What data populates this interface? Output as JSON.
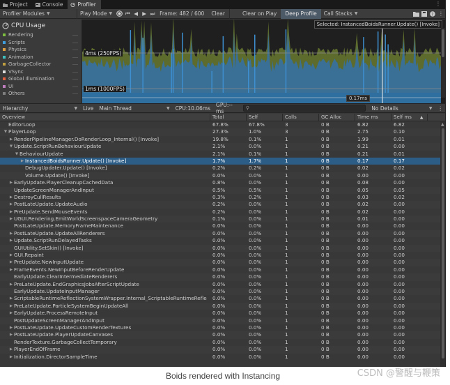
{
  "tabs": [
    {
      "label": "Project",
      "icon": "folder-icon"
    },
    {
      "label": "Console",
      "icon": "console-icon"
    },
    {
      "label": "Profiler",
      "icon": "profiler-icon"
    }
  ],
  "toolbar": {
    "modules": "Profiler Modules",
    "play_mode": "Play Mode",
    "frame": "Frame: 482 / 600",
    "clear": "Clear",
    "clear_on_play": "Clear on Play",
    "deep_profile": "Deep Profile",
    "call_stacks": "Call Stacks"
  },
  "chart": {
    "module_title": "CPU Usage",
    "selected": "Selected: InstancedBoidsRunner.Update() [Invoke]",
    "label_250": "4ms (250FPS)",
    "label_1000": "1ms (1000FPS)",
    "selection_ms": "0.17ms",
    "legend": [
      {
        "label": "Rendering",
        "color": "#7fbf3f"
      },
      {
        "label": "Scripts",
        "color": "#3f9fdf"
      },
      {
        "label": "Physics",
        "color": "#df9f3f"
      },
      {
        "label": "Animation",
        "color": "#3fbfbf"
      },
      {
        "label": "GarbageCollector",
        "color": "#bf9f3f"
      },
      {
        "label": "VSync",
        "color": "#dfdfdf"
      },
      {
        "label": "Global Illumination",
        "color": "#df5f3f"
      },
      {
        "label": "UI",
        "color": "#bf7fbf"
      },
      {
        "label": "Others",
        "color": "#7f7f7f"
      }
    ]
  },
  "hierarchy_bar": {
    "view": "Hierarchy",
    "live": "Live",
    "thread": "Main Thread",
    "cpu": "CPU:10.06ms",
    "gpu": "GPU:--ms",
    "search_icon": "search-icon",
    "details": "No Details"
  },
  "columns": [
    "Overview",
    "Total",
    "Self",
    "Calls",
    "GC Alloc",
    "Time ms",
    "Self ms"
  ],
  "rows": [
    {
      "indent": 0,
      "arrow": "",
      "name": "EditorLoop",
      "total": "67.8%",
      "self": "67.8%",
      "calls": "3",
      "gc": "0 B",
      "time": "6.82",
      "selfms": "6.82"
    },
    {
      "indent": 0,
      "arrow": "down",
      "name": "PlayerLoop",
      "total": "27.3%",
      "self": "1.0%",
      "calls": "3",
      "gc": "0 B",
      "time": "2.75",
      "selfms": "0.10"
    },
    {
      "indent": 1,
      "arrow": "right",
      "name": "RenderPipelineManager.DoRenderLoop_Internal() [Invoke]",
      "total": "19.8%",
      "self": "0.1%",
      "calls": "1",
      "gc": "0 B",
      "time": "1.99",
      "selfms": "0.01"
    },
    {
      "indent": 1,
      "arrow": "down",
      "name": "Update.ScriptRunBehaviourUpdate",
      "total": "2.1%",
      "self": "0.0%",
      "calls": "1",
      "gc": "0 B",
      "time": "0.21",
      "selfms": "0.00"
    },
    {
      "indent": 2,
      "arrow": "down",
      "name": "BehaviourUpdate",
      "total": "2.1%",
      "self": "0.1%",
      "calls": "1",
      "gc": "0 B",
      "time": "0.21",
      "selfms": "0.01"
    },
    {
      "indent": 3,
      "arrow": "right",
      "name": "InstancedBoidsRunner.Update() [Invoke]",
      "total": "1.7%",
      "self": "1.7%",
      "calls": "1",
      "gc": "0 B",
      "time": "0.17",
      "selfms": "0.17",
      "selected": true
    },
    {
      "indent": 3,
      "arrow": "",
      "name": "DebugUpdater.Update() [Invoke]",
      "total": "0.2%",
      "self": "0.2%",
      "calls": "1",
      "gc": "0 B",
      "time": "0.02",
      "selfms": "0.02"
    },
    {
      "indent": 3,
      "arrow": "",
      "name": "Volume.Update() [Invoke]",
      "total": "0.0%",
      "self": "0.0%",
      "calls": "1",
      "gc": "0 B",
      "time": "0.00",
      "selfms": "0.00"
    },
    {
      "indent": 1,
      "arrow": "right",
      "name": "EarlyUpdate.PlayerCleanupCachedData",
      "total": "0.8%",
      "self": "0.0%",
      "calls": "1",
      "gc": "0 B",
      "time": "0.08",
      "selfms": "0.00"
    },
    {
      "indent": 1,
      "arrow": "",
      "name": "UpdateScreenManagerAndInput",
      "total": "0.5%",
      "self": "0.5%",
      "calls": "1",
      "gc": "0 B",
      "time": "0.05",
      "selfms": "0.05"
    },
    {
      "indent": 1,
      "arrow": "right",
      "name": "DestroyCullResults",
      "total": "0.3%",
      "self": "0.2%",
      "calls": "1",
      "gc": "0 B",
      "time": "0.03",
      "selfms": "0.02"
    },
    {
      "indent": 1,
      "arrow": "right",
      "name": "PostLateUpdate.UpdateAudio",
      "total": "0.2%",
      "self": "0.0%",
      "calls": "1",
      "gc": "0 B",
      "time": "0.02",
      "selfms": "0.00"
    },
    {
      "indent": 1,
      "arrow": "right",
      "name": "PreUpdate.SendMouseEvents",
      "total": "0.2%",
      "self": "0.0%",
      "calls": "1",
      "gc": "0 B",
      "time": "0.02",
      "selfms": "0.00"
    },
    {
      "indent": 1,
      "arrow": "right",
      "name": "UGUI.Rendering.EmitWorldScreenspaceCameraGeometry",
      "total": "0.1%",
      "self": "0.0%",
      "calls": "1",
      "gc": "0 B",
      "time": "0.01",
      "selfms": "0.00"
    },
    {
      "indent": 1,
      "arrow": "",
      "name": "PostLateUpdate.MemoryFrameMaintenance",
      "total": "0.0%",
      "self": "0.0%",
      "calls": "1",
      "gc": "0 B",
      "time": "0.00",
      "selfms": "0.00"
    },
    {
      "indent": 1,
      "arrow": "right",
      "name": "PostLateUpdate.UpdateAllRenderers",
      "total": "0.0%",
      "self": "0.0%",
      "calls": "1",
      "gc": "0 B",
      "time": "0.00",
      "selfms": "0.00"
    },
    {
      "indent": 1,
      "arrow": "right",
      "name": "Update.ScriptRunDelayedTasks",
      "total": "0.0%",
      "self": "0.0%",
      "calls": "1",
      "gc": "0 B",
      "time": "0.00",
      "selfms": "0.00"
    },
    {
      "indent": 1,
      "arrow": "",
      "name": "GUIUtility.SetSkin() [Invoke]",
      "total": "0.0%",
      "self": "0.0%",
      "calls": "1",
      "gc": "0 B",
      "time": "0.00",
      "selfms": "0.00"
    },
    {
      "indent": 1,
      "arrow": "right",
      "name": "GUI.Repaint",
      "total": "0.0%",
      "self": "0.0%",
      "calls": "1",
      "gc": "0 B",
      "time": "0.00",
      "selfms": "0.00"
    },
    {
      "indent": 1,
      "arrow": "right",
      "name": "PreUpdate.NewInputUpdate",
      "total": "0.0%",
      "self": "0.0%",
      "calls": "1",
      "gc": "0 B",
      "time": "0.00",
      "selfms": "0.00"
    },
    {
      "indent": 1,
      "arrow": "right",
      "name": "FrameEvents.NewInputBeforeRenderUpdate",
      "total": "0.0%",
      "self": "0.0%",
      "calls": "1",
      "gc": "0 B",
      "time": "0.00",
      "selfms": "0.00"
    },
    {
      "indent": 1,
      "arrow": "",
      "name": "EarlyUpdate.ClearIntermediateRenderers",
      "total": "0.0%",
      "self": "0.0%",
      "calls": "1",
      "gc": "0 B",
      "time": "0.00",
      "selfms": "0.00"
    },
    {
      "indent": 1,
      "arrow": "right",
      "name": "PreLateUpdate.EndGraphicsJobsAfterScriptUpdate",
      "total": "0.0%",
      "self": "0.0%",
      "calls": "1",
      "gc": "0 B",
      "time": "0.00",
      "selfms": "0.00"
    },
    {
      "indent": 1,
      "arrow": "",
      "name": "EarlyUpdate.UpdateInputManager",
      "total": "0.0%",
      "self": "0.0%",
      "calls": "1",
      "gc": "0 B",
      "time": "0.00",
      "selfms": "0.00"
    },
    {
      "indent": 1,
      "arrow": "right",
      "name": "ScriptableRuntimeReflectionSystemWrapper.Internal_ScriptableRuntimeRefle",
      "total": "0.0%",
      "self": "0.0%",
      "calls": "1",
      "gc": "0 B",
      "time": "0.00",
      "selfms": "0.00"
    },
    {
      "indent": 1,
      "arrow": "right",
      "name": "PreLateUpdate.ParticleSystemBeginUpdateAll",
      "total": "0.0%",
      "self": "0.0%",
      "calls": "1",
      "gc": "0 B",
      "time": "0.00",
      "selfms": "0.00"
    },
    {
      "indent": 1,
      "arrow": "right",
      "name": "EarlyUpdate.ProcessRemoteInput",
      "total": "0.0%",
      "self": "0.0%",
      "calls": "1",
      "gc": "0 B",
      "time": "0.00",
      "selfms": "0.00"
    },
    {
      "indent": 1,
      "arrow": "",
      "name": "PostUpdateScreenManagerAndInput",
      "total": "0.0%",
      "self": "0.0%",
      "calls": "1",
      "gc": "0 B",
      "time": "0.00",
      "selfms": "0.00"
    },
    {
      "indent": 1,
      "arrow": "right",
      "name": "PostLateUpdate.UpdateCustomRenderTextures",
      "total": "0.0%",
      "self": "0.0%",
      "calls": "1",
      "gc": "0 B",
      "time": "0.00",
      "selfms": "0.00"
    },
    {
      "indent": 1,
      "arrow": "right",
      "name": "PostLateUpdate.PlayerUpdateCanvases",
      "total": "0.0%",
      "self": "0.0%",
      "calls": "1",
      "gc": "0 B",
      "time": "0.00",
      "selfms": "0.00"
    },
    {
      "indent": 1,
      "arrow": "",
      "name": "RenderTexture.GarbageCollectTemporary",
      "total": "0.0%",
      "self": "0.0%",
      "calls": "1",
      "gc": "0 B",
      "time": "0.00",
      "selfms": "0.00"
    },
    {
      "indent": 1,
      "arrow": "right",
      "name": "PlayerEndOfFrame",
      "total": "0.0%",
      "self": "0.0%",
      "calls": "1",
      "gc": "0 B",
      "time": "0.00",
      "selfms": "0.00"
    },
    {
      "indent": 1,
      "arrow": "right",
      "name": "Initialization.DirectorSampleTime",
      "total": "0.0%",
      "self": "0.0%",
      "calls": "1",
      "gc": "0 B",
      "time": "0.00",
      "selfms": "0.00"
    }
  ],
  "caption": "Boids rendered with Instancing",
  "watermark": "CSDN @警醒与鞭策"
}
